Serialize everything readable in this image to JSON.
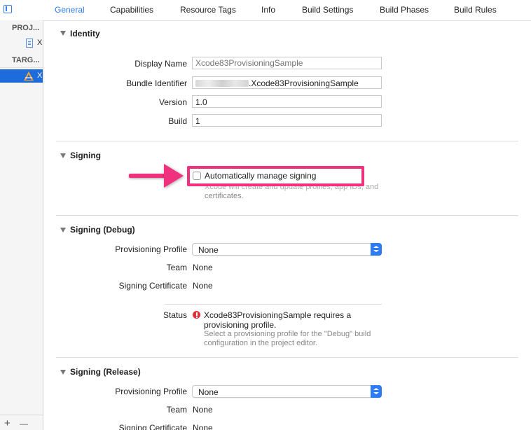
{
  "tabs": [
    "General",
    "Capabilities",
    "Resource Tags",
    "Info",
    "Build Settings",
    "Build Phases",
    "Build Rules"
  ],
  "active_tab": "General",
  "sidebar": {
    "project_header": "PROJ...",
    "project_item": "X",
    "targets_header": "TARG...",
    "target_item": "X",
    "add_button": "+",
    "remove_button": "—"
  },
  "identity": {
    "title": "Identity",
    "display_name_label": "Display Name",
    "display_name_placeholder": "Xcode83ProvisioningSample",
    "bundle_identifier_label": "Bundle Identifier",
    "bundle_identifier_value": ".Xcode83ProvisioningSample",
    "version_label": "Version",
    "version_value": "1.0",
    "build_label": "Build",
    "build_value": "1"
  },
  "signing": {
    "title": "Signing",
    "auto_manage_label": "Automatically manage signing",
    "auto_manage_checked": false,
    "help_line1": "Xcode will create and update profiles, app IDs, and",
    "help_line2": "certificates."
  },
  "signing_debug": {
    "title": "Signing (Debug)",
    "profile_label": "Provisioning Profile",
    "profile_value": "None",
    "team_label": "Team",
    "team_value": "None",
    "certificate_label": "Signing Certificate",
    "certificate_value": "None",
    "status_label": "Status",
    "status_line1": "Xcode83ProvisioningSample requires a",
    "status_line2": "provisioning profile.",
    "status_help1": "Select a provisioning profile for the \"Debug\" build",
    "status_help2": "configuration in the project editor."
  },
  "signing_release": {
    "title": "Signing (Release)",
    "profile_label": "Provisioning Profile",
    "profile_value": "None",
    "team_label": "Team",
    "team_value": "None",
    "certificate_label": "Signing Certificate",
    "certificate_value": "None"
  },
  "colors": {
    "accent": "#2d7bf6",
    "highlight": "#f0317d",
    "error": "#e0323d",
    "selection": "#1e6bdb"
  }
}
